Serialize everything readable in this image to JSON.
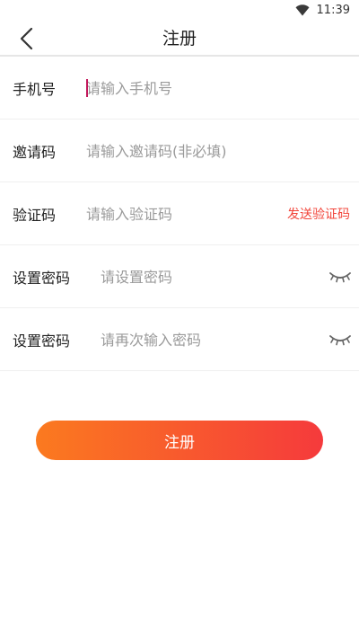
{
  "status_bar": {
    "time": "11:39",
    "icon": "wifi-icon"
  },
  "header": {
    "title": "注册",
    "back_icon": "back-chevron-icon"
  },
  "form": {
    "phone": {
      "label": "手机号",
      "placeholder": "请输入手机号"
    },
    "invite": {
      "label": "邀请码",
      "placeholder": "请输入邀请码(非必填)"
    },
    "code": {
      "label": "验证码",
      "placeholder": "请输入验证码",
      "action": "发送验证码"
    },
    "password": {
      "label": "设置密码",
      "placeholder": "请设置密码",
      "icon": "eye-closed-icon"
    },
    "password_confirm": {
      "label": "设置密码",
      "placeholder": "请再次输入密码",
      "icon": "eye-closed-icon"
    }
  },
  "submit": {
    "label": "注册"
  },
  "colors": {
    "accent_start": "#fb7a1f",
    "accent_end": "#f53a3c",
    "link": "#f2453a"
  }
}
